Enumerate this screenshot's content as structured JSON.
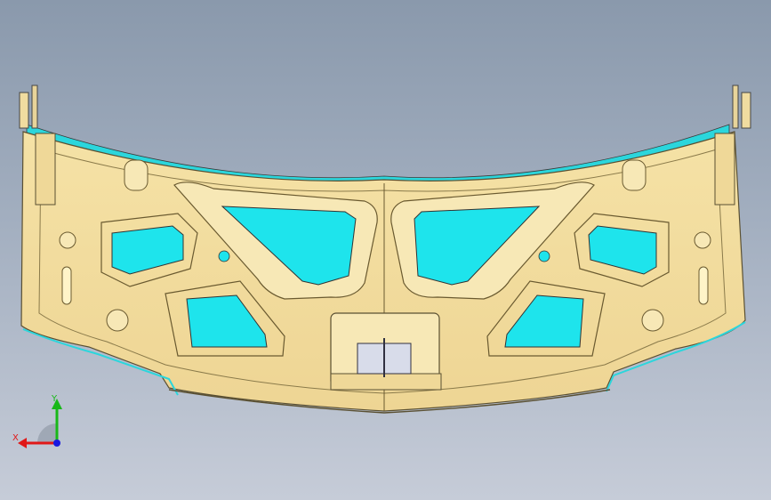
{
  "viewport": {
    "background_top": "#8a99ac",
    "background_bottom": "#c6ccd8"
  },
  "model": {
    "part": "hood-inner-panel",
    "body_color": "#f2dc9c",
    "edge_color": "#5a5032",
    "cutout_color": "#1ee4ec",
    "flange_color": "#2bd6dc"
  },
  "triad": {
    "x_label": "X",
    "y_label": "Y",
    "x_color": "#e01818",
    "y_color": "#18b818",
    "z_color": "#1818e0"
  }
}
